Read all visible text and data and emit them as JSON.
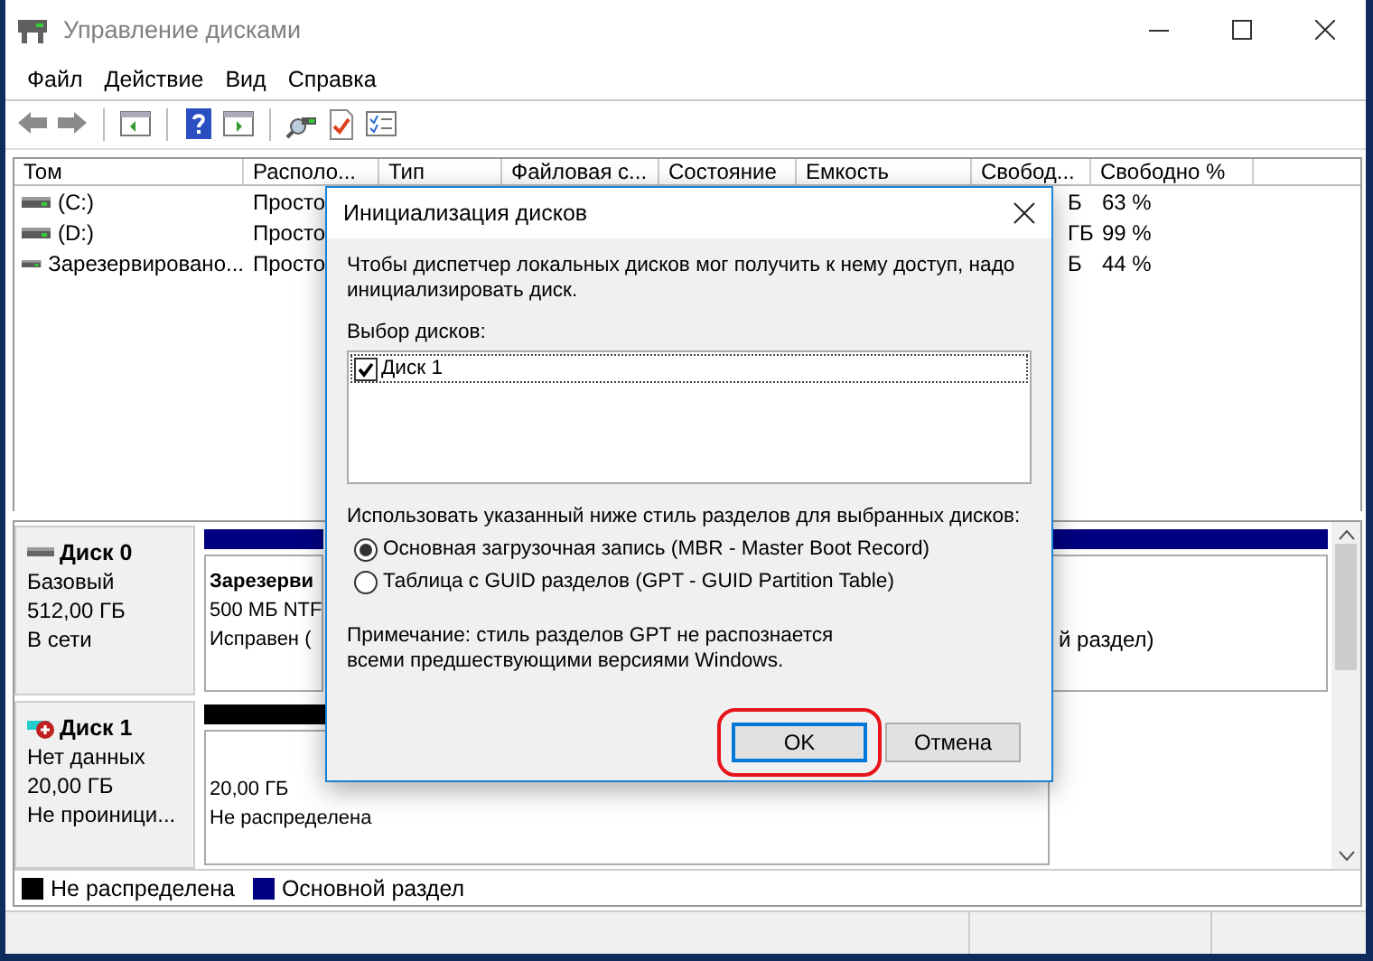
{
  "window": {
    "title": "Управление дисками"
  },
  "menu": [
    "Файл",
    "Действие",
    "Вид",
    "Справка"
  ],
  "volumes": {
    "columns": [
      "Том",
      "Располо...",
      "Тип",
      "Файловая с...",
      "Состояние",
      "Емкость",
      "Свобод...",
      "Свободно %"
    ],
    "rows": [
      {
        "volume": "(C:)",
        "layout": "Просто",
        "free": "Б",
        "free_percent": "63 %"
      },
      {
        "volume": "(D:)",
        "layout": "Просто",
        "free": "ГБ",
        "free_percent": "99 %"
      },
      {
        "volume": "Зарезервировано...",
        "layout": "Просто",
        "free": "Б",
        "free_percent": "44 %"
      }
    ]
  },
  "disks": [
    {
      "name": "Диск 0",
      "kind": "online",
      "type": "Базовый",
      "size": "512,00 ГБ",
      "status": "В сети",
      "partitions": [
        {
          "kind": "primary",
          "lines": [
            "Зарезерви",
            "500 МБ NTF",
            "Исправен ("
          ]
        },
        {
          "kind": "primary",
          "lines": [
            "й раздел)"
          ]
        }
      ]
    },
    {
      "name": "Диск 1",
      "kind": "uninitialized",
      "type": "Нет данных",
      "size": "20,00 ГБ",
      "status": "Не проиници...",
      "partitions": [
        {
          "kind": "unallocated",
          "lines": [
            "20,00 ГБ",
            "Не распределена"
          ]
        }
      ]
    }
  ],
  "legend": [
    {
      "label": "Не распределена",
      "color": "#000000"
    },
    {
      "label": "Основной раздел",
      "color": "#000080"
    }
  ],
  "dialog": {
    "title": "Инициализация дисков",
    "message": "Чтобы диспетчер локальных дисков мог получить к нему доступ, надо инициализировать диск.",
    "disk_list_label": "Выбор дисков:",
    "disk_list": [
      {
        "label": "Диск 1",
        "checked": true
      }
    ],
    "style_label": "Использовать указанный ниже стиль разделов для выбранных дисков:",
    "styles": [
      {
        "label": "Основная загрузочная запись (MBR - Master Boot Record)",
        "selected": true
      },
      {
        "label": "Таблица с GUID разделов (GPT - GUID Partition Table)",
        "selected": false
      }
    ],
    "note": "Примечание: стиль разделов GPT не распознается всеми предшествующими версиями Windows.",
    "buttons": [
      {
        "label": "OK",
        "default": true,
        "highlighted": true
      },
      {
        "label": "Отмена",
        "default": false,
        "highlighted": false
      }
    ]
  }
}
